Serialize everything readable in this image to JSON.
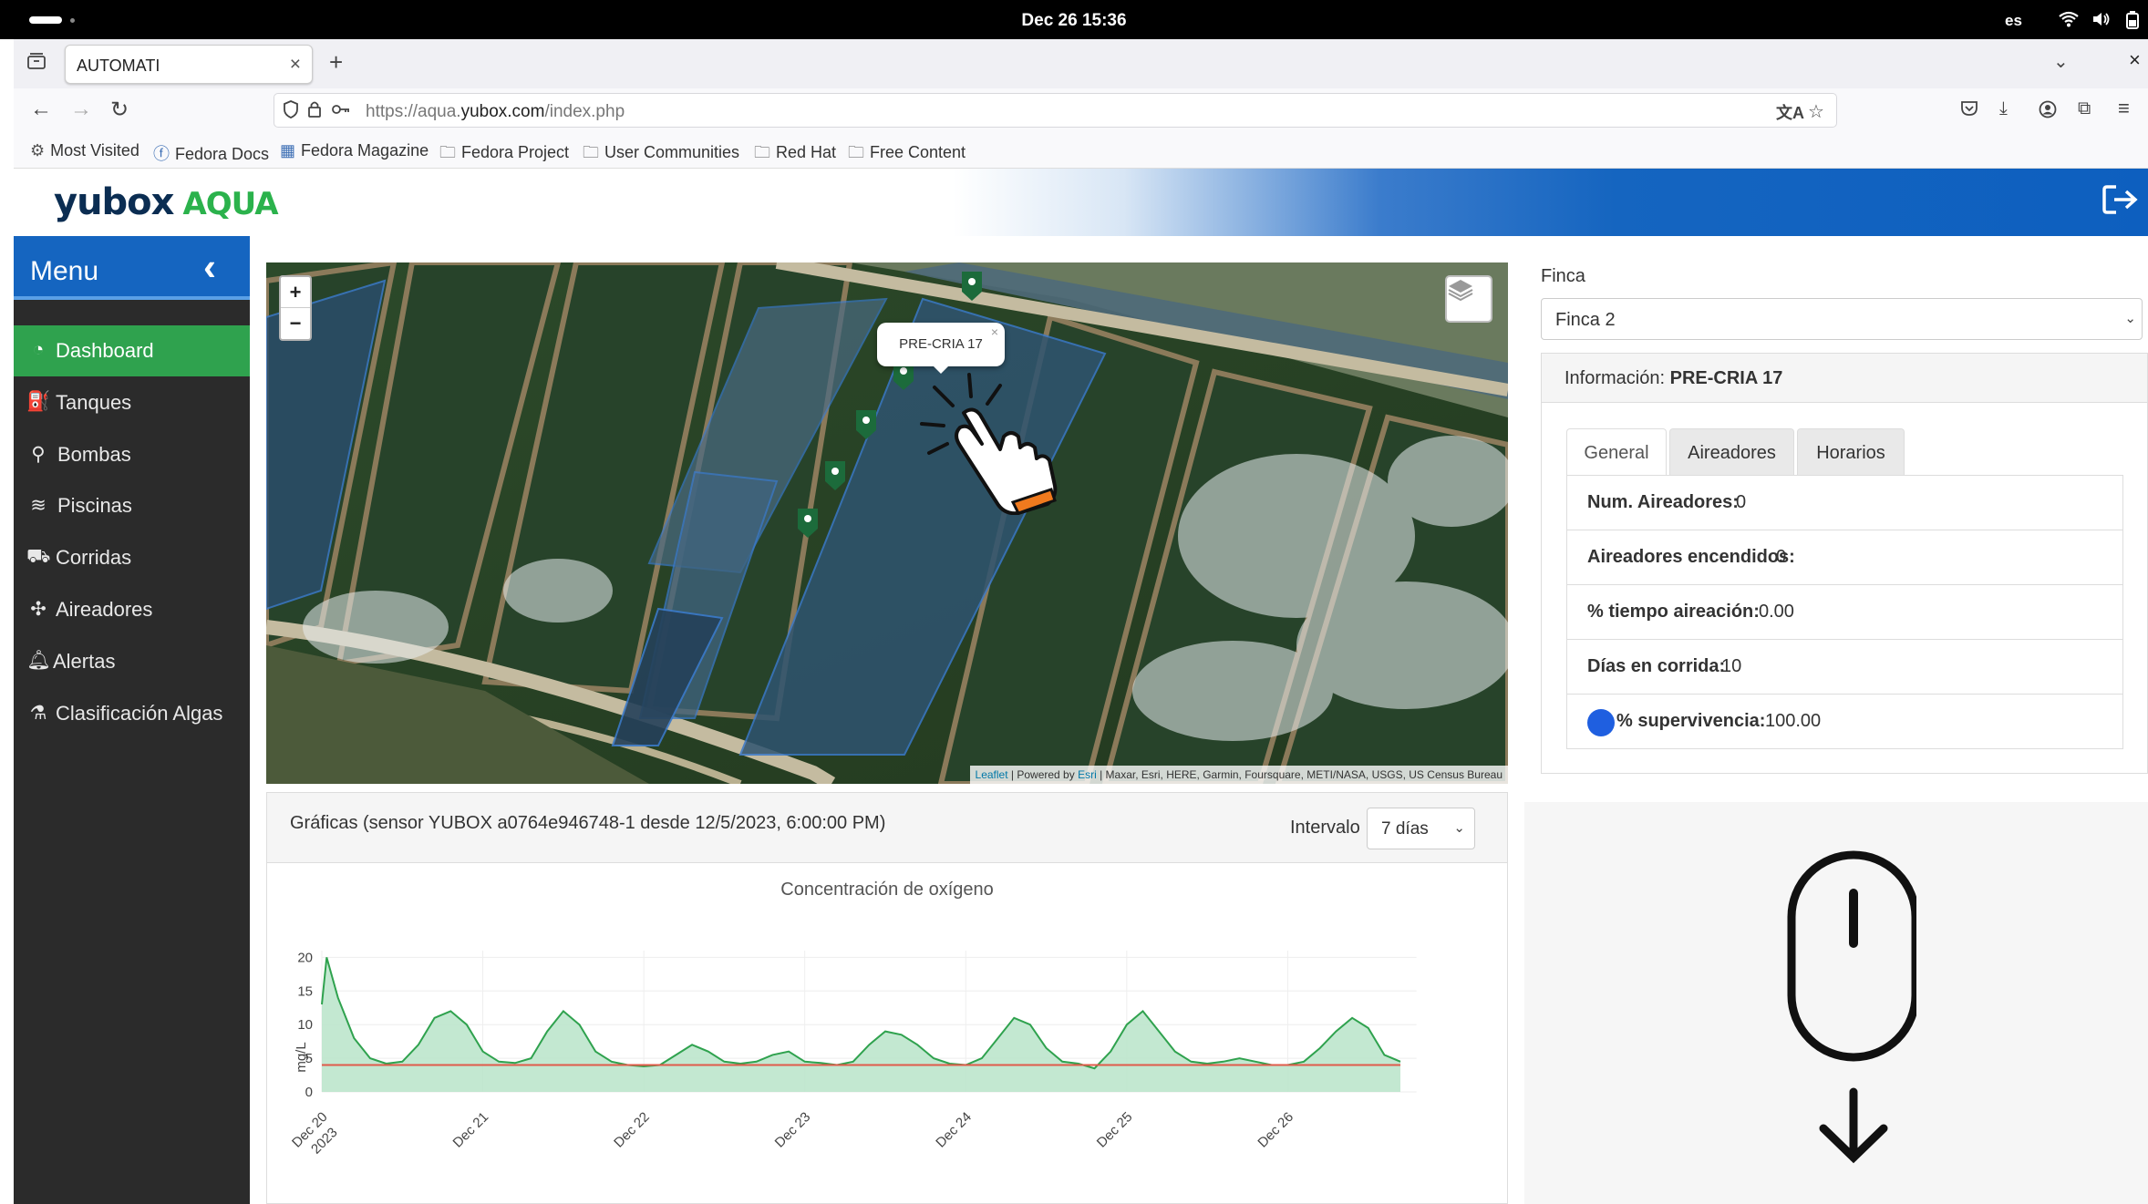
{
  "os": {
    "clock": "Dec 26  15:36",
    "lang": "es"
  },
  "browser": {
    "tab_title": "AUTOMATI",
    "url_prefix": "https://aqua.",
    "url_domain": "yubox.com",
    "url_suffix": "/index.php",
    "bookmarks": [
      {
        "icon": "gear-icon",
        "label": "Most Visited"
      },
      {
        "icon": "fedora-icon",
        "label": "Fedora Docs"
      },
      {
        "icon": "magazine-icon",
        "label": "Fedora Magazine"
      },
      {
        "icon": "folder-icon",
        "label": "Fedora Project"
      },
      {
        "icon": "folder-icon",
        "label": "User Communities"
      },
      {
        "icon": "folder-icon",
        "label": "Red Hat"
      },
      {
        "icon": "folder-icon",
        "label": "Free Content"
      }
    ]
  },
  "app": {
    "logo_main": "yubox",
    "logo_sub": "AQUA",
    "brand_color": "#1565c0",
    "accent_color": "#2fa24e"
  },
  "sidebar": {
    "title": "Menu",
    "items": [
      {
        "label": "Dashboard",
        "icon": "dashboard-icon",
        "active": true
      },
      {
        "label": "Tanques",
        "icon": "tank-icon"
      },
      {
        "label": "Bombas",
        "icon": "pump-icon"
      },
      {
        "label": "Piscinas",
        "icon": "pools-icon"
      },
      {
        "label": "Corridas",
        "icon": "runs-icon"
      },
      {
        "label": "Aireadores",
        "icon": "fan-icon"
      },
      {
        "label": "Alertas",
        "icon": "bell-icon"
      },
      {
        "label": "Clasificación Algas",
        "icon": "algae-icon"
      }
    ]
  },
  "map": {
    "popup_label": "PRE-CRIA 17",
    "attribution_leaflet": "Leaflet",
    "attribution_powered": " | Powered by ",
    "attribution_esri": "Esri",
    "attribution_rest": " | Maxar, Esri, HERE, Garmin, Foursquare, METI/NASA, USGS, US Census Bureau",
    "zoom_in": "+",
    "zoom_out": "−"
  },
  "charts": {
    "header": "Gráficas (sensor YUBOX a0764e946748-1 desde 12/5/2023, 6:00:00 PM)",
    "interval_label": "Intervalo",
    "interval_value": "7 días"
  },
  "chart_data": {
    "type": "area",
    "title": "Concentración de oxígeno",
    "ylabel": "mg/L",
    "xlabel": "",
    "ylim": [
      0,
      21
    ],
    "yticks": [
      0,
      5,
      10,
      15,
      20
    ],
    "xticks": [
      {
        "label": "Dec 20",
        "label2": "2023"
      },
      {
        "label": "Dec 21"
      },
      {
        "label": "Dec 22"
      },
      {
        "label": "Dec 23"
      },
      {
        "label": "Dec 24"
      },
      {
        "label": "Dec 25"
      },
      {
        "label": "Dec 26"
      }
    ],
    "x_days": [
      0,
      0.03,
      0.1,
      0.2,
      0.3,
      0.4,
      0.5,
      0.6,
      0.7,
      0.8,
      0.9,
      1.0,
      1.1,
      1.2,
      1.3,
      1.4,
      1.5,
      1.6,
      1.7,
      1.8,
      1.9,
      2.0,
      2.1,
      2.2,
      2.3,
      2.4,
      2.5,
      2.6,
      2.7,
      2.8,
      2.9,
      3.0,
      3.1,
      3.2,
      3.3,
      3.4,
      3.5,
      3.6,
      3.7,
      3.8,
      3.9,
      4.0,
      4.1,
      4.2,
      4.3,
      4.4,
      4.5,
      4.6,
      4.7,
      4.8,
      4.9,
      5.0,
      5.1,
      5.2,
      5.3,
      5.4,
      5.5,
      5.6,
      5.7,
      5.8,
      5.9,
      6.0,
      6.1,
      6.2,
      6.3,
      6.4,
      6.5,
      6.6,
      6.7
    ],
    "series": [
      {
        "values": [
          13,
          20,
          14,
          8,
          5,
          4.2,
          4.5,
          7,
          11,
          12,
          10,
          6,
          4.5,
          4.3,
          5,
          9,
          12,
          10,
          6,
          4.5,
          4,
          3.8,
          4,
          5.5,
          7,
          6,
          4.5,
          4.2,
          4.5,
          5.5,
          6,
          4.5,
          4.3,
          4,
          4.5,
          7,
          9,
          8.5,
          7,
          5,
          4.2,
          4,
          5,
          8,
          11,
          10,
          6.5,
          4.5,
          4.2,
          3.5,
          6,
          10,
          12,
          9,
          6,
          4.5,
          4.2,
          4.5,
          5,
          4.5,
          4,
          4,
          4.5,
          6.5,
          9,
          11,
          9.5,
          5.5,
          4.5
        ]
      }
    ],
    "reference_lines": [
      {
        "value": 4,
        "color": "#e05a4a"
      }
    ],
    "fill_color": "#b9e4c9",
    "line_color": "#2fa24e",
    "grid": true
  },
  "finca": {
    "label": "Finca",
    "value": "Finca 2"
  },
  "info": {
    "prefix": "Información: ",
    "name": "PRE-CRIA 17",
    "tabs": [
      "General",
      "Aireadores",
      "Horarios"
    ],
    "rows": [
      {
        "key": "Num. Aireadores:",
        "value": " 0"
      },
      {
        "key": "Aireadores encendidos:",
        "value": " 0"
      },
      {
        "key": "% tiempo aireación:",
        "value": " 0.00"
      },
      {
        "key": "Días en corrida:",
        "value": " 10"
      },
      {
        "key": "% supervivencia:",
        "value": " 100.00"
      }
    ],
    "survival_color": "#1f5fe0"
  }
}
